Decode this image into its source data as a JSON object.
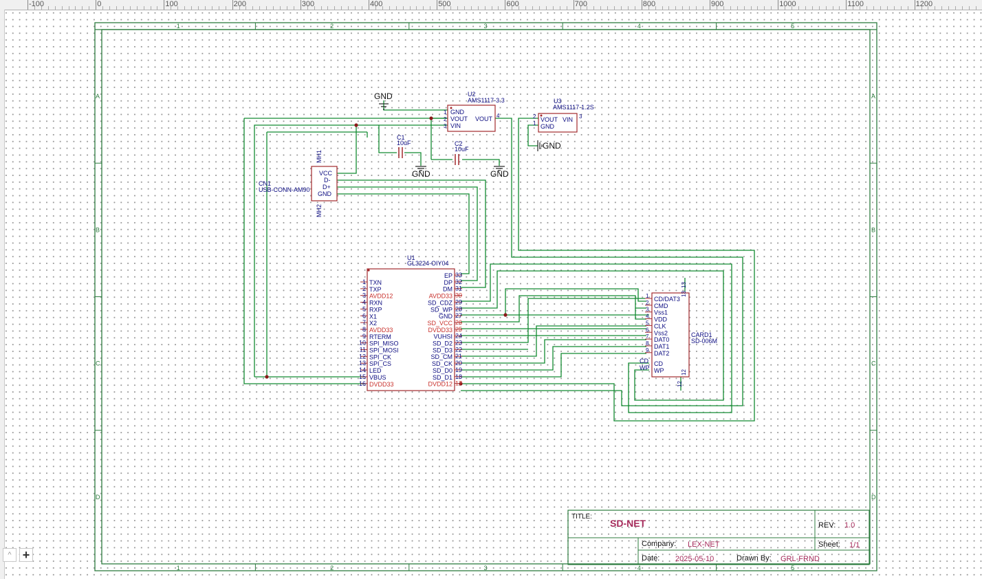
{
  "ruler": {
    "labels": [
      "-100",
      "0",
      "100",
      "200",
      "300",
      "400",
      "500",
      "600",
      "700",
      "800",
      "900",
      "1000",
      "1100",
      "1200"
    ]
  },
  "frame": {
    "columns": [
      "1",
      "2",
      "3",
      "4",
      "5"
    ],
    "rows": [
      "A",
      "B",
      "C",
      "D"
    ]
  },
  "title_block": {
    "title_label": "TITLE:",
    "title": "SD-NET",
    "rev_label": "REV:",
    "rev": "1.0",
    "company_label": "Company:",
    "company": "LEX-NET",
    "sheet_label": "Sheet:",
    "sheet": "1/1",
    "date_label": "Date:",
    "date": "2025-05-10",
    "drawn_label": "Drawn By:",
    "drawn": "GRL-FRND"
  },
  "components": {
    "u2": {
      "ref": "U2",
      "value": "AMS1117-3.3",
      "pins_left": [
        "GND",
        "VOUT",
        "VIN"
      ],
      "pins_right": [
        "VOUT"
      ],
      "left_nums": [
        "1",
        "2",
        "3"
      ],
      "right_nums": [
        "4"
      ]
    },
    "u3": {
      "ref": "U3",
      "value": "AMS1117-1.2S",
      "pins_left": [
        "VOUT",
        "GND"
      ],
      "pins_right": [
        "VIN"
      ],
      "left_nums": [
        "2",
        "1"
      ],
      "right_nums": [
        "3"
      ]
    },
    "c1": {
      "ref": "C1",
      "value": "10uF"
    },
    "c2": {
      "ref": "C2",
      "value": "10uF"
    },
    "gnd_labels": [
      "GND",
      "GND",
      "GND",
      "GND"
    ],
    "cn1": {
      "ref": "CN1",
      "value": "USB-CONN-AM90",
      "pins": [
        "VCC",
        "D-",
        "D+",
        "GND"
      ],
      "mh1": "MH1",
      "mh2": "MH2"
    },
    "u1": {
      "ref": "U1",
      "value": "GL3224-OIY04",
      "left_pins": [
        {
          "num": "1",
          "name": "TXN",
          "red": false
        },
        {
          "num": "2",
          "name": "TXP",
          "red": false
        },
        {
          "num": "3",
          "name": "AVDD12",
          "red": true
        },
        {
          "num": "4",
          "name": "RXN",
          "red": false
        },
        {
          "num": "5",
          "name": "RXP",
          "red": false
        },
        {
          "num": "6",
          "name": "X1",
          "red": false
        },
        {
          "num": "7",
          "name": "X2",
          "red": false
        },
        {
          "num": "8",
          "name": "AVDD33",
          "red": true
        },
        {
          "num": "9",
          "name": "RTERM",
          "red": false
        },
        {
          "num": "10",
          "name": "SPI_MISO",
          "red": false
        },
        {
          "num": "11",
          "name": "SPI_MOSI",
          "red": false
        },
        {
          "num": "12",
          "name": "SPI_CK",
          "red": false
        },
        {
          "num": "13",
          "name": "SPI_CS",
          "red": false
        },
        {
          "num": "14",
          "name": "LED",
          "red": false
        },
        {
          "num": "15",
          "name": "VBUS",
          "red": false
        },
        {
          "num": "16",
          "name": "DVDD33",
          "red": true
        }
      ],
      "right_pins": [
        {
          "num": "33",
          "name": "EP",
          "red": false
        },
        {
          "num": "32",
          "name": "DP",
          "red": false
        },
        {
          "num": "31",
          "name": "DM",
          "red": false
        },
        {
          "num": "30",
          "name": "AVDD33",
          "red": true
        },
        {
          "num": "29",
          "name": "SD_CDZ",
          "red": false
        },
        {
          "num": "28",
          "name": "SD_WP",
          "red": false
        },
        {
          "num": "27",
          "name": "GND",
          "red": false
        },
        {
          "num": "26",
          "name": "SD_VCC",
          "red": true
        },
        {
          "num": "25",
          "name": "DVDD33",
          "red": true
        },
        {
          "num": "24",
          "name": "VUHSI",
          "red": false
        },
        {
          "num": "23",
          "name": "SD_D2",
          "red": false
        },
        {
          "num": "22",
          "name": "SD_D3",
          "red": false
        },
        {
          "num": "21",
          "name": "SD_CM",
          "red": false
        },
        {
          "num": "20",
          "name": "SD_CK",
          "red": false
        },
        {
          "num": "19",
          "name": "SD_D0",
          "red": false
        },
        {
          "num": "18",
          "name": "SD_D1",
          "red": false
        },
        {
          "num": "17",
          "name": "DVDD12",
          "red": true
        }
      ]
    },
    "card1": {
      "ref": "CARD1",
      "value": "SD-006M",
      "pins": [
        {
          "num": "1",
          "name": "CD/DAT3"
        },
        {
          "num": "2",
          "name": "CMD"
        },
        {
          "num": "3",
          "name": "Vss1"
        },
        {
          "num": "4",
          "name": "VDD"
        },
        {
          "num": "5",
          "name": "CLK"
        },
        {
          "num": "6",
          "name": "Vss2"
        },
        {
          "num": "7",
          "name": "DAT0"
        },
        {
          "num": "8",
          "name": "DAT1"
        },
        {
          "num": "9",
          "name": "DAT2"
        }
      ],
      "extra_pins": [
        {
          "num": "CD",
          "name": "CD"
        },
        {
          "num": "WP",
          "name": "WP"
        }
      ],
      "top_num": "13",
      "bottom_num": "12"
    }
  },
  "zoom": {
    "up": "^",
    "plus": "+"
  },
  "colors": {
    "wire": "#118a30",
    "part": "#a2282c",
    "text": "#0b0b80",
    "red_pin": "#c8302b",
    "frame": "#2c7b3e",
    "title_value": "#a52a5a"
  }
}
